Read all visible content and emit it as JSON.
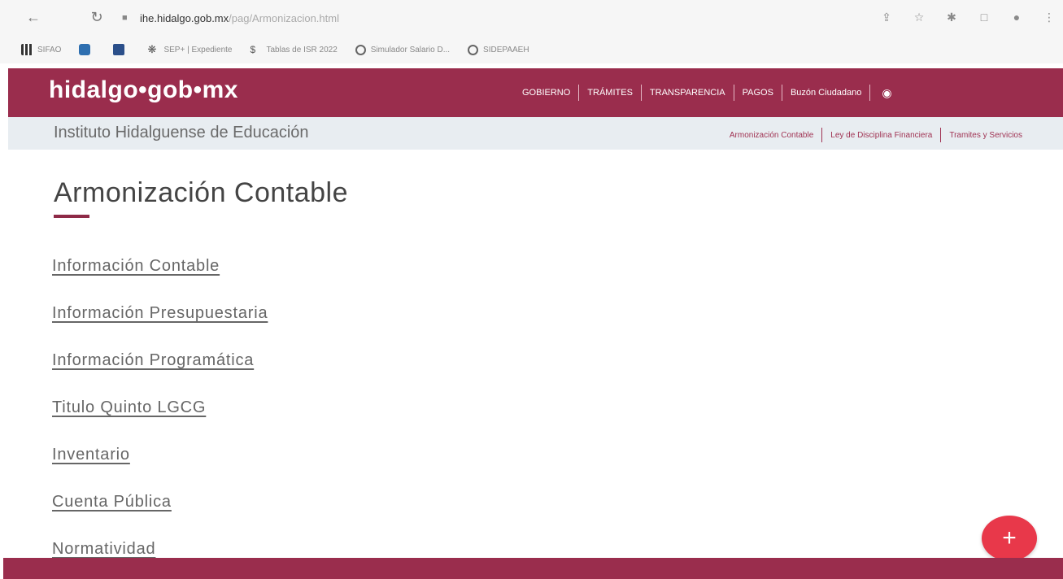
{
  "browser": {
    "url_host": "ihe.hidalgo.gob.mx",
    "url_path": "/pag/Armonizacion.html",
    "bookmarks": [
      {
        "label": "SIFAO",
        "icon": "grid-icon"
      },
      {
        "label": "",
        "icon": "app-icon"
      },
      {
        "label": "",
        "icon": "sheet-icon"
      },
      {
        "label": "SEP+ | Expediente",
        "icon": "star-icon"
      },
      {
        "label": "Tablas de ISR 2022",
        "icon": "dollar-icon"
      },
      {
        "label": "Simulador Salario D...",
        "icon": "globe-icon"
      },
      {
        "label": "SIDEPAAEH",
        "icon": "globe-icon"
      }
    ]
  },
  "header": {
    "logo": "hidalgo•gob•mx",
    "nav": [
      "GOBIERNO",
      "TRÁMITES",
      "TRANSPARENCIA",
      "PAGOS",
      "Buzón Ciudadano"
    ]
  },
  "subheader": {
    "institute": "Instituto Hidalguense de Educación",
    "nav": [
      "Armonización Contable",
      "Ley de Disciplina Financiera",
      "Tramites y Servicios"
    ]
  },
  "main": {
    "title": "Armonización Contable",
    "links": [
      "Información Contable",
      "Información Presupuestaria",
      "Información Programática",
      "Titulo Quinto LGCG",
      "Inventario",
      "Cuenta Pública",
      "Normatividad"
    ]
  },
  "fab": {
    "label": "+"
  },
  "colors": {
    "brand": "#9a2d4d",
    "fab": "#e8384a",
    "subheader_bg": "#e8edf1"
  }
}
